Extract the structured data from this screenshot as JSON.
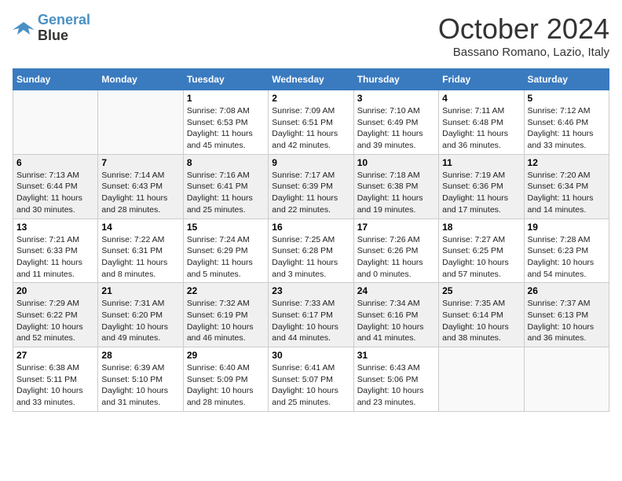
{
  "header": {
    "logo_line1": "General",
    "logo_line2": "Blue",
    "month": "October 2024",
    "location": "Bassano Romano, Lazio, Italy"
  },
  "weekdays": [
    "Sunday",
    "Monday",
    "Tuesday",
    "Wednesday",
    "Thursday",
    "Friday",
    "Saturday"
  ],
  "weeks": [
    [
      {
        "day": "",
        "info": ""
      },
      {
        "day": "",
        "info": ""
      },
      {
        "day": "1",
        "info": "Sunrise: 7:08 AM\nSunset: 6:53 PM\nDaylight: 11 hours and 45 minutes."
      },
      {
        "day": "2",
        "info": "Sunrise: 7:09 AM\nSunset: 6:51 PM\nDaylight: 11 hours and 42 minutes."
      },
      {
        "day": "3",
        "info": "Sunrise: 7:10 AM\nSunset: 6:49 PM\nDaylight: 11 hours and 39 minutes."
      },
      {
        "day": "4",
        "info": "Sunrise: 7:11 AM\nSunset: 6:48 PM\nDaylight: 11 hours and 36 minutes."
      },
      {
        "day": "5",
        "info": "Sunrise: 7:12 AM\nSunset: 6:46 PM\nDaylight: 11 hours and 33 minutes."
      }
    ],
    [
      {
        "day": "6",
        "info": "Sunrise: 7:13 AM\nSunset: 6:44 PM\nDaylight: 11 hours and 30 minutes."
      },
      {
        "day": "7",
        "info": "Sunrise: 7:14 AM\nSunset: 6:43 PM\nDaylight: 11 hours and 28 minutes."
      },
      {
        "day": "8",
        "info": "Sunrise: 7:16 AM\nSunset: 6:41 PM\nDaylight: 11 hours and 25 minutes."
      },
      {
        "day": "9",
        "info": "Sunrise: 7:17 AM\nSunset: 6:39 PM\nDaylight: 11 hours and 22 minutes."
      },
      {
        "day": "10",
        "info": "Sunrise: 7:18 AM\nSunset: 6:38 PM\nDaylight: 11 hours and 19 minutes."
      },
      {
        "day": "11",
        "info": "Sunrise: 7:19 AM\nSunset: 6:36 PM\nDaylight: 11 hours and 17 minutes."
      },
      {
        "day": "12",
        "info": "Sunrise: 7:20 AM\nSunset: 6:34 PM\nDaylight: 11 hours and 14 minutes."
      }
    ],
    [
      {
        "day": "13",
        "info": "Sunrise: 7:21 AM\nSunset: 6:33 PM\nDaylight: 11 hours and 11 minutes."
      },
      {
        "day": "14",
        "info": "Sunrise: 7:22 AM\nSunset: 6:31 PM\nDaylight: 11 hours and 8 minutes."
      },
      {
        "day": "15",
        "info": "Sunrise: 7:24 AM\nSunset: 6:29 PM\nDaylight: 11 hours and 5 minutes."
      },
      {
        "day": "16",
        "info": "Sunrise: 7:25 AM\nSunset: 6:28 PM\nDaylight: 11 hours and 3 minutes."
      },
      {
        "day": "17",
        "info": "Sunrise: 7:26 AM\nSunset: 6:26 PM\nDaylight: 11 hours and 0 minutes."
      },
      {
        "day": "18",
        "info": "Sunrise: 7:27 AM\nSunset: 6:25 PM\nDaylight: 10 hours and 57 minutes."
      },
      {
        "day": "19",
        "info": "Sunrise: 7:28 AM\nSunset: 6:23 PM\nDaylight: 10 hours and 54 minutes."
      }
    ],
    [
      {
        "day": "20",
        "info": "Sunrise: 7:29 AM\nSunset: 6:22 PM\nDaylight: 10 hours and 52 minutes."
      },
      {
        "day": "21",
        "info": "Sunrise: 7:31 AM\nSunset: 6:20 PM\nDaylight: 10 hours and 49 minutes."
      },
      {
        "day": "22",
        "info": "Sunrise: 7:32 AM\nSunset: 6:19 PM\nDaylight: 10 hours and 46 minutes."
      },
      {
        "day": "23",
        "info": "Sunrise: 7:33 AM\nSunset: 6:17 PM\nDaylight: 10 hours and 44 minutes."
      },
      {
        "day": "24",
        "info": "Sunrise: 7:34 AM\nSunset: 6:16 PM\nDaylight: 10 hours and 41 minutes."
      },
      {
        "day": "25",
        "info": "Sunrise: 7:35 AM\nSunset: 6:14 PM\nDaylight: 10 hours and 38 minutes."
      },
      {
        "day": "26",
        "info": "Sunrise: 7:37 AM\nSunset: 6:13 PM\nDaylight: 10 hours and 36 minutes."
      }
    ],
    [
      {
        "day": "27",
        "info": "Sunrise: 6:38 AM\nSunset: 5:11 PM\nDaylight: 10 hours and 33 minutes."
      },
      {
        "day": "28",
        "info": "Sunrise: 6:39 AM\nSunset: 5:10 PM\nDaylight: 10 hours and 31 minutes."
      },
      {
        "day": "29",
        "info": "Sunrise: 6:40 AM\nSunset: 5:09 PM\nDaylight: 10 hours and 28 minutes."
      },
      {
        "day": "30",
        "info": "Sunrise: 6:41 AM\nSunset: 5:07 PM\nDaylight: 10 hours and 25 minutes."
      },
      {
        "day": "31",
        "info": "Sunrise: 6:43 AM\nSunset: 5:06 PM\nDaylight: 10 hours and 23 minutes."
      },
      {
        "day": "",
        "info": ""
      },
      {
        "day": "",
        "info": ""
      }
    ]
  ]
}
